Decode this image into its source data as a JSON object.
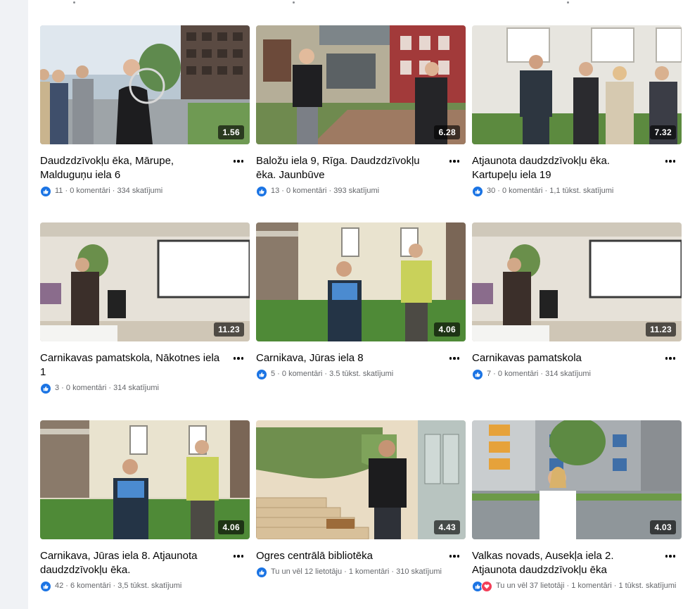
{
  "videos": [
    {
      "title": "Daudzdzīvokļu ēka, Mārupe, Malduguņu iela 6",
      "duration": "1.56",
      "meta": "11 · 0 komentāri · 334 skatījumi",
      "reactions": [
        "like"
      ]
    },
    {
      "title": "Baložu iela 9, Rīga. Daudzdzīvokļu ēka. Jaunbūve",
      "duration": "6.28",
      "meta": "13 · 0 komentāri · 393 skatījumi",
      "reactions": [
        "like"
      ]
    },
    {
      "title": "Atjaunota daudzdzīvokļu ēka. Kartupeļu iela 19",
      "duration": "7.32",
      "meta": "30 · 0 komentāri · 1,1 tūkst. skatījumi",
      "reactions": [
        "like"
      ]
    },
    {
      "title": "Carnikavas pamatskola, Nākotnes iela 1",
      "duration": "11.23",
      "meta": "3 · 0 komentāri · 314 skatījumi",
      "reactions": [
        "like"
      ]
    },
    {
      "title": "Carnikava, Jūras iela 8",
      "duration": "4.06",
      "meta": "5 · 0 komentāri · 3.5 tūkst. skatījumi",
      "reactions": [
        "like"
      ]
    },
    {
      "title": "Carnikavas pamatskola",
      "duration": "11.23",
      "meta": "7 · 0 komentāri · 314 skatījumi",
      "reactions": [
        "like"
      ]
    },
    {
      "title": "Carnikava, Jūras iela 8. Atjaunota daudzdzīvokļu ēka.",
      "duration": "4.06",
      "meta": "42 · 6 komentāri · 3,5 tūkst. skatījumi",
      "reactions": [
        "like"
      ]
    },
    {
      "title": "Ogres centrālā bibliotēka",
      "duration": "4.43",
      "meta": "Tu un vēl 12 lietotāju · 1 komentāri · 310 skatījumi",
      "reactions": [
        "like"
      ]
    },
    {
      "title": "Valkas novads, Ausekļa iela 2. Atjaunota daudzdzīvokļu ēka",
      "duration": "4.03",
      "meta": "Tu un vēl 37 lietotāji · 1 komentāri · 1 tūkst. skatījumi",
      "reactions": [
        "like",
        "love"
      ]
    }
  ],
  "colors": {
    "like": "#1b74e4",
    "love": "#f33e58",
    "text": "#050505",
    "meta": "#65676b"
  }
}
